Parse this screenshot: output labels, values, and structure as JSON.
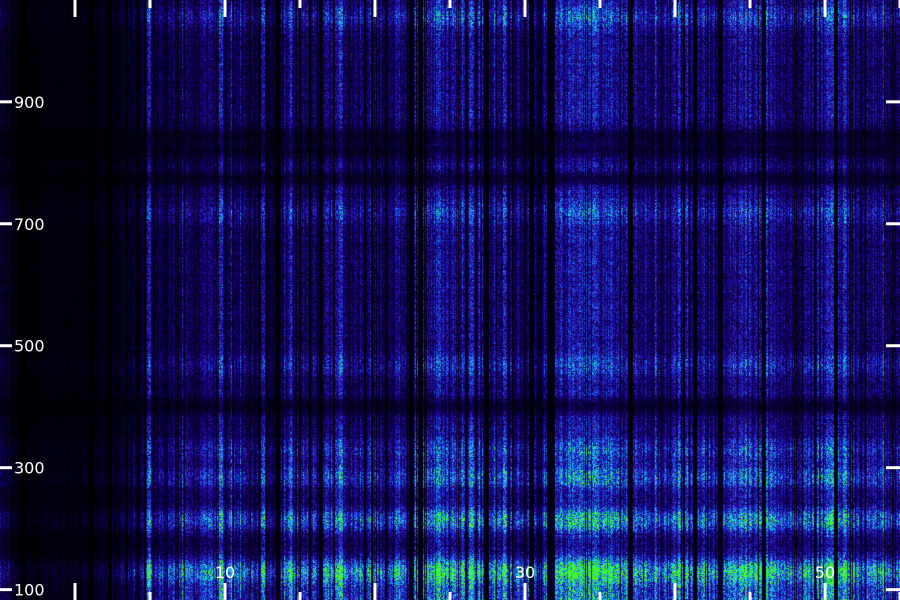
{
  "chart_data": {
    "type": "heatmap",
    "title": "",
    "xlabel": "",
    "ylabel": "",
    "x_ticks": {
      "major_labeled": [
        10,
        30,
        50
      ],
      "major_all": [
        0,
        10,
        20,
        30,
        40,
        50,
        60
      ],
      "minor": [
        5,
        15,
        25,
        35,
        45,
        55
      ]
    },
    "y_ticks": [
      100,
      300,
      500,
      700,
      900
    ],
    "xlim": [
      -5,
      55
    ],
    "ylim": [
      83,
      1067
    ],
    "colormap": [
      "#000000",
      "#10005a",
      "#2a17c8",
      "#1f6ff0",
      "#14d4f4",
      "#2af060",
      "#4dff10"
    ],
    "bright_columns_x": [
      4.9,
      9.7,
      12.5,
      14.3,
      17.7,
      24.2,
      26.4,
      28.6,
      33.0,
      34.6,
      36.9,
      40.2,
      43.0,
      44.8,
      46.0,
      50.2,
      50.5,
      51.3
    ],
    "dark_columns_x": [
      -3.5,
      1.1,
      2.3,
      13.5,
      22.4,
      23.0,
      27.4,
      30.4,
      31.6,
      37.0,
      41.3,
      43.0,
      45.9,
      50.7
    ],
    "bands_y": [
      {
        "y": 130,
        "level": 0.95
      },
      {
        "y": 215,
        "level": 0.75
      },
      {
        "y": 285,
        "level": 0.5
      },
      {
        "y": 330,
        "level": 0.35
      },
      {
        "y": 470,
        "level": 0.25
      },
      {
        "y": 720,
        "level": 0.25
      },
      {
        "y": 1040,
        "level": 0.35
      }
    ],
    "dark_bands_y": [
      820,
      845,
      775,
      402
    ],
    "activity_by_x": [
      {
        "x": -5,
        "v": 0.25
      },
      {
        "x": -3.5,
        "v": 0.05
      },
      {
        "x": 0,
        "v": 0.08
      },
      {
        "x": 2.5,
        "v": 0.15
      },
      {
        "x": 5,
        "v": 0.35
      },
      {
        "x": 8,
        "v": 0.5
      },
      {
        "x": 10,
        "v": 0.55
      },
      {
        "x": 13,
        "v": 0.3
      },
      {
        "x": 14,
        "v": 0.5
      },
      {
        "x": 17,
        "v": 0.65
      },
      {
        "x": 19,
        "v": 0.5
      },
      {
        "x": 22,
        "v": 0.55
      },
      {
        "x": 24,
        "v": 0.75
      },
      {
        "x": 26,
        "v": 0.7
      },
      {
        "x": 28,
        "v": 0.6
      },
      {
        "x": 30,
        "v": 0.5
      },
      {
        "x": 31,
        "v": 0.4
      },
      {
        "x": 32,
        "v": 0.85
      },
      {
        "x": 34,
        "v": 0.9
      },
      {
        "x": 36,
        "v": 0.8
      },
      {
        "x": 39,
        "v": 0.55
      },
      {
        "x": 42,
        "v": 0.7
      },
      {
        "x": 45,
        "v": 0.75
      },
      {
        "x": 48,
        "v": 0.55
      },
      {
        "x": 51,
        "v": 0.8
      },
      {
        "x": 53,
        "v": 0.6
      },
      {
        "x": 55,
        "v": 0.55
      }
    ],
    "axis_color": "#ffffff"
  }
}
